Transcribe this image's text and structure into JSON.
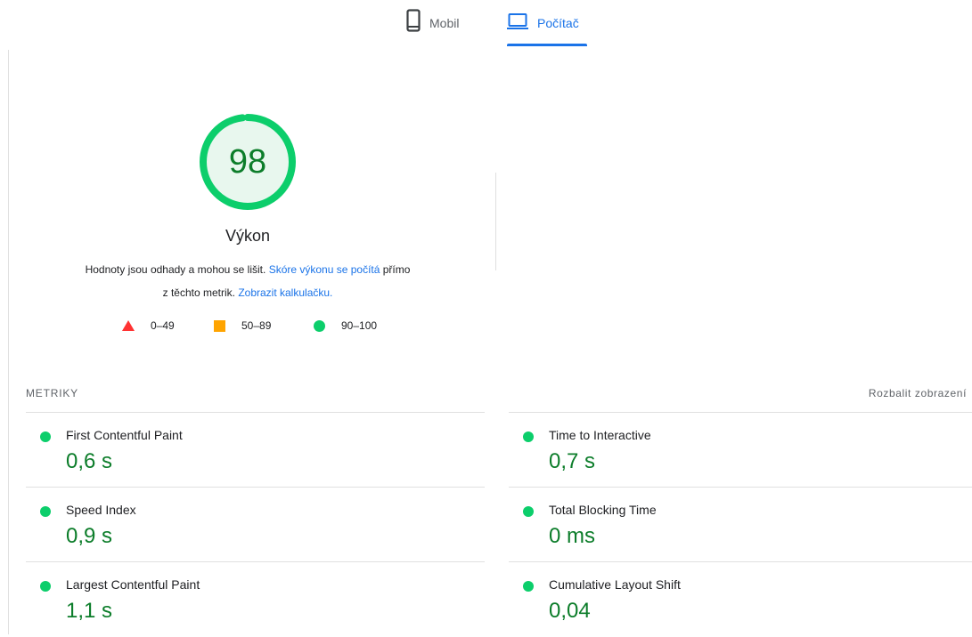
{
  "tabs": [
    {
      "label": "Mobil",
      "icon": "phone-icon",
      "active": false
    },
    {
      "label": "Počítač",
      "icon": "laptop-icon",
      "active": true
    }
  ],
  "gauge": {
    "score": "98",
    "title": "Výkon",
    "fraction": 0.98,
    "color": "#0cce6b",
    "fill": "#e8f7ee"
  },
  "description": {
    "text1": "Hodnoty jsou odhady a mohou se lišit. ",
    "link1": "Skóre výkonu se počítá",
    "text2": " přímo",
    "text3": "z těchto metrik. ",
    "link2": "Zobrazit kalkulačku."
  },
  "legend": [
    {
      "range": "0–49",
      "shape": "triangle",
      "color": "#ff3333"
    },
    {
      "range": "50–89",
      "shape": "square",
      "color": "#ffa400"
    },
    {
      "range": "90–100",
      "shape": "circle",
      "color": "#0cce6b"
    }
  ],
  "metrics": {
    "header": "METRIKY",
    "expand_label": "Rozbalit zobrazení",
    "items": [
      {
        "title": "First Contentful Paint",
        "value": "0,6 s"
      },
      {
        "title": "Time to Interactive",
        "value": "0,7 s"
      },
      {
        "title": "Speed Index",
        "value": "0,9 s"
      },
      {
        "title": "Total Blocking Time",
        "value": "0 ms"
      },
      {
        "title": "Largest Contentful Paint",
        "value": "1,1 s"
      },
      {
        "title": "Cumulative Layout Shift",
        "value": "0,04"
      }
    ]
  }
}
